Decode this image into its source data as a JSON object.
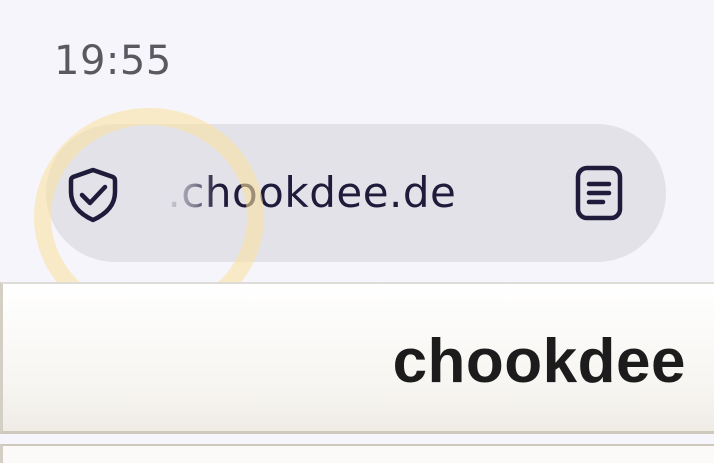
{
  "status_bar": {
    "time": "19:55"
  },
  "browser": {
    "url_display": "m.chookdee.de",
    "icons": {
      "security": "shield-check-icon",
      "reader": "reader-mode-icon"
    },
    "colors": {
      "bar_background": "#e3e2e9",
      "icon_color": "#1f1b3b",
      "tap_highlight": "#fae1a0"
    }
  },
  "page": {
    "brand_title": "chookdee"
  }
}
